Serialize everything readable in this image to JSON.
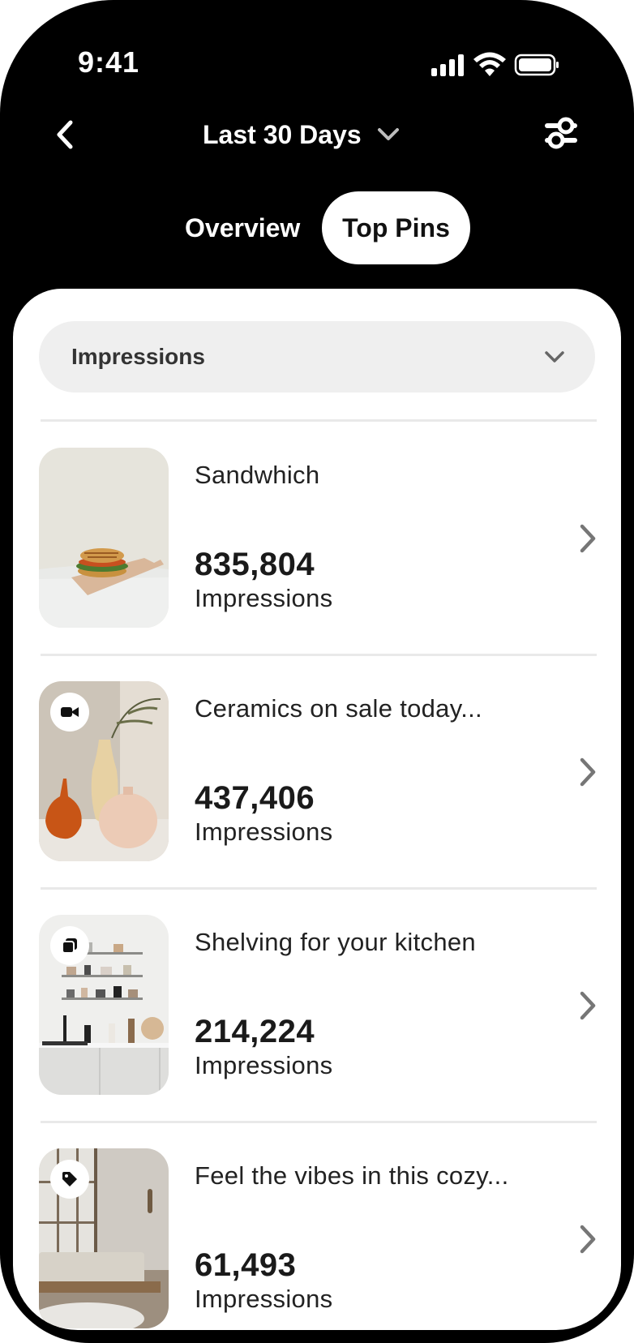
{
  "status_bar": {
    "time": "9:41",
    "icons": [
      "signal-icon",
      "wifi-icon",
      "battery-icon"
    ]
  },
  "nav": {
    "back_icon": "chevron-left-icon",
    "date_range": "Last 30 Days",
    "date_range_icon": "chevron-down-icon",
    "filter_icon": "sliders-icon"
  },
  "tabs": [
    {
      "label": "Overview",
      "selected": false
    },
    {
      "label": "Top Pins",
      "selected": true
    }
  ],
  "metric_select": {
    "value": "Impressions",
    "icon": "chevron-down-icon"
  },
  "pins": [
    {
      "title": "Sandwhich",
      "value": "835,804",
      "metric": "Impressions",
      "badge": null,
      "image": "sandwich-photo"
    },
    {
      "title": "Ceramics on sale today...",
      "value": "437,406",
      "metric": "Impressions",
      "badge": "video-icon",
      "image": "ceramic-vases-photo"
    },
    {
      "title": "Shelving for your kitchen",
      "value": "214,224",
      "metric": "Impressions",
      "badge": "carousel-icon",
      "image": "kitchen-shelves-photo"
    },
    {
      "title": "Feel the vibes in this cozy...",
      "value": "61,493",
      "metric": "Impressions",
      "badge": "tag-icon",
      "image": "cozy-room-photo"
    }
  ],
  "colors": {
    "background": "#000000",
    "surface": "#ffffff",
    "select_fill": "#efefef",
    "divider": "#e9e9e9",
    "text_primary": "#1a1a1a"
  }
}
